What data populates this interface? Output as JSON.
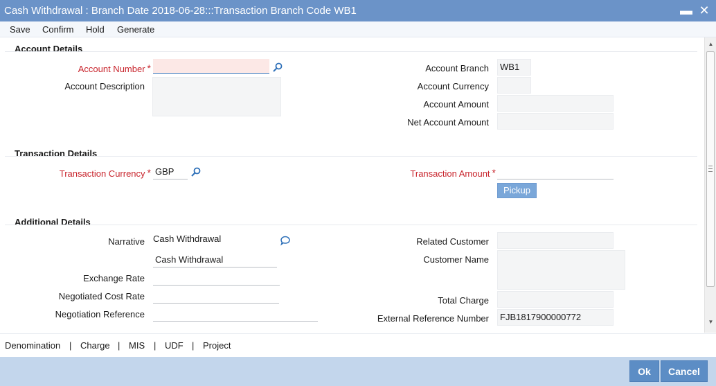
{
  "window": {
    "title": "Cash Withdrawal : Branch Date 2018-06-28:::Transaction Branch Code WB1",
    "minimize_symbol": "▬",
    "close_symbol": "✕"
  },
  "toolbar": {
    "save": "Save",
    "confirm": "Confirm",
    "hold": "Hold",
    "generate": "Generate"
  },
  "account_details": {
    "heading": "Account Details",
    "account_number_label": "Account Number",
    "account_number_value": "",
    "account_description_label": "Account Description",
    "account_description_value": "",
    "account_branch_label": "Account Branch",
    "account_branch_value": "WB1",
    "account_currency_label": "Account Currency",
    "account_currency_value": "",
    "account_amount_label": "Account Amount",
    "account_amount_value": "",
    "net_account_amount_label": "Net Account Amount",
    "net_account_amount_value": ""
  },
  "transaction_details": {
    "heading": "Transaction Details",
    "transaction_currency_label": "Transaction Currency",
    "transaction_currency_value": "GBP",
    "transaction_amount_label": "Transaction Amount",
    "transaction_amount_value": "",
    "pickup_button": "Pickup"
  },
  "additional_details": {
    "heading": "Additional Details",
    "narrative_label": "Narrative",
    "narrative_value": "Cash Withdrawal",
    "exchange_rate_label": "Exchange Rate",
    "exchange_rate_value": "",
    "negotiated_cost_rate_label": "Negotiated Cost Rate",
    "negotiated_cost_rate_value": "",
    "negotiation_reference_label": "Negotiation Reference",
    "negotiation_reference_value": "",
    "related_customer_label": "Related Customer",
    "related_customer_value": "",
    "customer_name_label": "Customer Name",
    "customer_name_value": "",
    "total_charge_label": "Total Charge",
    "total_charge_value": "",
    "external_reference_number_label": "External Reference Number",
    "external_reference_number_value": "FJB1817900000772"
  },
  "required_marker": "*",
  "bottom_links": {
    "denomination": "Denomination",
    "charge": "Charge",
    "mis": "MIS",
    "udf": "UDF",
    "project": "Project",
    "separator": "|"
  },
  "footer": {
    "ok": "Ok",
    "cancel": "Cancel"
  },
  "colors": {
    "title_bar": "#6b93c8",
    "required_label": "#c8242c",
    "footer_bar": "#c3d6ec",
    "button": "#5c8dc5"
  }
}
